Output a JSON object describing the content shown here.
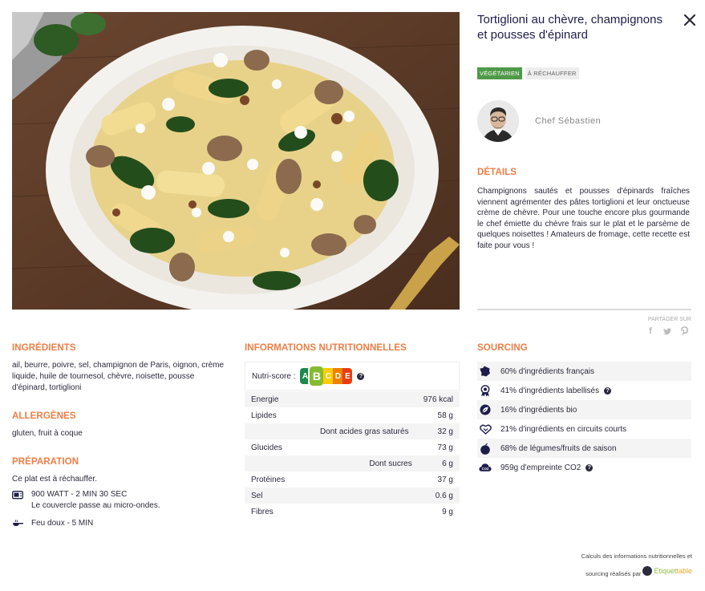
{
  "recipe": {
    "title": "Tortiglioni au chèvre, champignons et pousses d'épinard",
    "badges": [
      "VÉGÉTARIEN",
      "À RÉCHAUFFER"
    ],
    "chef_name": "Chef Sébastien"
  },
  "details": {
    "heading": "DÉTAILS",
    "text": "Champignons sautés et pousses d'épinards fraîches viennent agrémenter des pâtes tortiglioni et leur onctueuse crème de chèvre. Pour une touche encore plus gourmande le chef émiette du chèvre frais sur le plat et le parsème de quelques noisettes ! Amateurs de fromage, cette recette est faite pour vous !"
  },
  "share": {
    "label": "PARTAGER SUR",
    "networks": [
      "facebook-icon",
      "twitter-icon",
      "pinterest-icon"
    ]
  },
  "ingredients": {
    "heading": "INGRÉDIENTS",
    "text": "ail, beurre, poivre, sel, champignon de Paris, oignon, crème liquide, huile de tournesol, chèvre, noisette, pousse d'épinard, tortiglioni"
  },
  "allergens": {
    "heading": "ALLERGÈNES",
    "text": "gluten, fruit à coque"
  },
  "preparation": {
    "heading": "PRÉPARATION",
    "intro": "Ce plat est à réchauffer.",
    "microwave_line1": "900 WATT - 2 MIN 30 SEC",
    "microwave_line2": "Le couvercle passe au micro-ondes.",
    "stove": "Feu doux - 5 MIN"
  },
  "nutrition": {
    "heading": "INFORMATIONS NUTRITIONNELLES",
    "nutriscore_label": "Nutri-score :",
    "nutriscore_value": "B",
    "nutriscore_letters": [
      "A",
      "B",
      "C",
      "D",
      "E"
    ],
    "rows": [
      {
        "label": "Energie",
        "value": "976 kcal"
      },
      {
        "label": "Lipides",
        "value": "58 g"
      },
      {
        "label": "Dont acides gras saturés",
        "value": "32 g"
      },
      {
        "label": "Glucides",
        "value": "73 g"
      },
      {
        "label": "Dont sucres",
        "value": "6 g"
      },
      {
        "label": "Protéines",
        "value": "37 g"
      },
      {
        "label": "Sel",
        "value": "0.6 g"
      },
      {
        "label": "Fibres",
        "value": "9 g"
      }
    ]
  },
  "sourcing": {
    "heading": "SOURCING",
    "rows": [
      {
        "icon": "france-map-icon",
        "text": "60% d'ingrédients français"
      },
      {
        "icon": "label-medal-icon",
        "text": "41% d'ingrédients labellisés"
      },
      {
        "icon": "organic-leaf-icon",
        "text": "16% d'ingrédients bio"
      },
      {
        "icon": "handshake-icon",
        "text": "21% d'ingrédients en circuits courts"
      },
      {
        "icon": "fruit-icon",
        "text": "68% de légumes/fruits de saison"
      },
      {
        "icon": "co2-cloud-icon",
        "text": "959g d'empreinte CO2"
      }
    ]
  },
  "footer": {
    "line1": "Calculs des informations nutritionnelles et",
    "line2": "sourcing réalisés par",
    "brand_part1": "Etiquet",
    "brand_part2": "table"
  },
  "colors": {
    "accent": "#ef7d45",
    "title": "#1d1d4a",
    "vegetarian": "#4f9a48"
  }
}
